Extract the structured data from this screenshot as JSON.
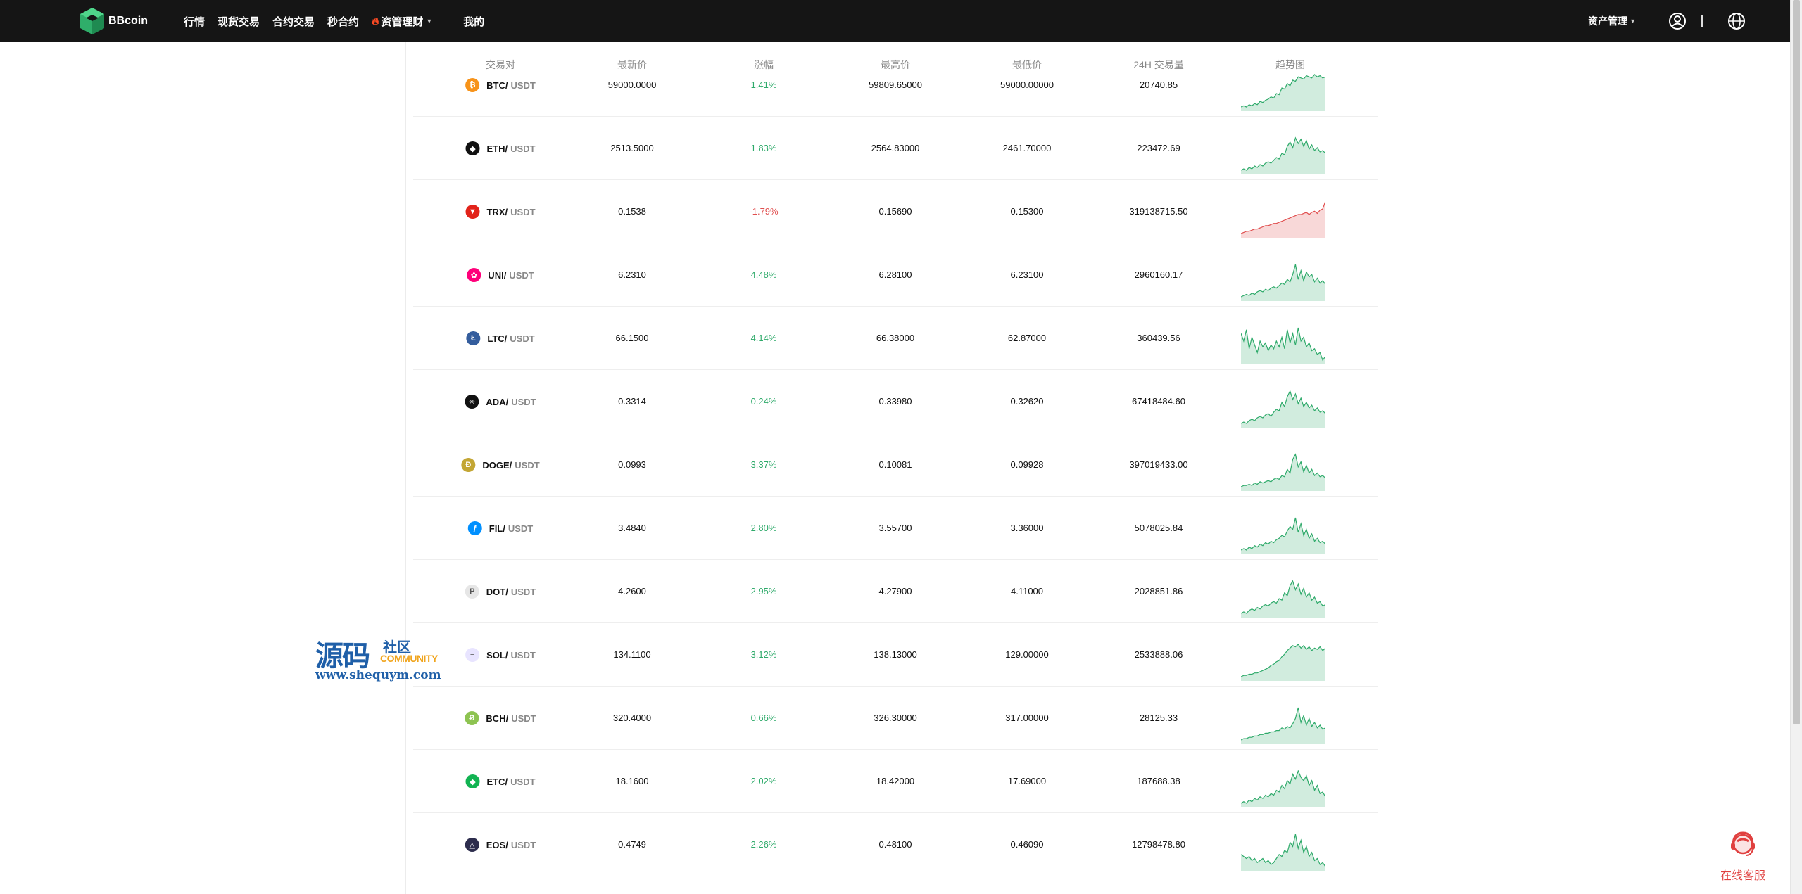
{
  "brand": {
    "name": "BBcoin"
  },
  "nav": {
    "items": [
      {
        "label": "行情"
      },
      {
        "label": "现货交易"
      },
      {
        "label": "合约交易"
      },
      {
        "label": "秒合约"
      },
      {
        "label": "资管理财",
        "hot": true,
        "dropdown": true
      },
      {
        "label": "我的"
      }
    ],
    "asset_management": "资产管理",
    "icons": {
      "user": "user-circle-icon",
      "language": "globe-icon"
    }
  },
  "table": {
    "headers": [
      "交易对",
      "最新价",
      "涨幅",
      "最高价",
      "最低价",
      "24H 交易量",
      "趋势图"
    ],
    "rows": [
      {
        "base": "BTC/",
        "quote": "USDT",
        "price": "59000.0000",
        "change": "1.41%",
        "high": "59809.65000",
        "low": "59000.00000",
        "volume": "20740.85",
        "direction": "up",
        "icon_color": "#f7931a",
        "icon_glyph": "₿",
        "spark": [
          3,
          4,
          3,
          5,
          4,
          6,
          5,
          8,
          7,
          9,
          10,
          12,
          11,
          15,
          14,
          20,
          19,
          24,
          22,
          27,
          26,
          30,
          29,
          28,
          31,
          30,
          29,
          32,
          30,
          31,
          29,
          30
        ]
      },
      {
        "base": "ETH/",
        "quote": "USDT",
        "price": "2513.5000",
        "change": "1.83%",
        "high": "2564.83000",
        "low": "2461.70000",
        "volume": "223472.69",
        "direction": "up",
        "icon_color": "#111111",
        "icon_glyph": "◆",
        "spark": [
          5,
          6,
          5,
          7,
          6,
          8,
          7,
          9,
          8,
          10,
          11,
          10,
          12,
          14,
          13,
          17,
          16,
          22,
          25,
          21,
          28,
          24,
          27,
          22,
          26,
          20,
          23,
          19,
          21,
          18,
          19,
          17
        ]
      },
      {
        "base": "TRX/",
        "quote": "USDT",
        "price": "0.1538",
        "change": "-1.79%",
        "high": "0.15690",
        "low": "0.15300",
        "volume": "319138715.50",
        "direction": "down",
        "icon_color": "#e2231a",
        "icon_glyph": "▼",
        "spark": [
          3,
          4,
          5,
          5,
          6,
          7,
          7,
          8,
          9,
          10,
          10,
          11,
          12,
          12,
          13,
          14,
          15,
          16,
          17,
          18,
          19,
          20,
          20,
          21,
          22,
          20,
          22,
          23,
          21,
          24,
          25,
          32
        ]
      },
      {
        "base": "UNI/",
        "quote": "USDT",
        "price": "6.2310",
        "change": "4.48%",
        "high": "6.28100",
        "low": "6.23100",
        "volume": "2960160.17",
        "direction": "up",
        "icon_color": "#ff007a",
        "icon_glyph": "✿",
        "spark": [
          4,
          5,
          6,
          5,
          7,
          6,
          8,
          9,
          8,
          10,
          9,
          11,
          12,
          11,
          13,
          15,
          14,
          18,
          16,
          22,
          30,
          18,
          25,
          17,
          24,
          20,
          22,
          16,
          19,
          15,
          17,
          14
        ]
      },
      {
        "base": "LTC/",
        "quote": "USDT",
        "price": "66.1500",
        "change": "4.14%",
        "high": "66.38000",
        "low": "62.87000",
        "volume": "360439.56",
        "direction": "up",
        "icon_color": "#345d9d",
        "icon_glyph": "Ł",
        "spark": [
          22,
          18,
          24,
          14,
          20,
          16,
          12,
          18,
          15,
          17,
          13,
          16,
          14,
          18,
          15,
          20,
          14,
          24,
          17,
          22,
          16,
          25,
          18,
          20,
          15,
          17,
          13,
          14,
          11,
          12,
          8,
          10
        ]
      },
      {
        "base": "ADA/",
        "quote": "USDT",
        "price": "0.3314",
        "change": "0.24%",
        "high": "0.33980",
        "low": "0.32620",
        "volume": "67418484.60",
        "direction": "up",
        "icon_color": "#111111",
        "icon_glyph": "✳",
        "spark": [
          5,
          6,
          5,
          7,
          8,
          7,
          9,
          10,
          9,
          11,
          12,
          10,
          13,
          15,
          14,
          20,
          17,
          24,
          28,
          22,
          26,
          19,
          23,
          17,
          20,
          16,
          18,
          14,
          16,
          13,
          14,
          12
        ]
      },
      {
        "base": "DOGE/",
        "quote": "USDT",
        "price": "0.0993",
        "change": "3.37%",
        "high": "0.10081",
        "low": "0.09928",
        "volume": "397019433.00",
        "direction": "up",
        "icon_color": "#c3a634",
        "icon_glyph": "Ð",
        "spark": [
          4,
          5,
          5,
          6,
          5,
          7,
          6,
          8,
          7,
          8,
          9,
          8,
          10,
          11,
          10,
          13,
          12,
          18,
          15,
          26,
          30,
          20,
          24,
          16,
          21,
          15,
          18,
          13,
          15,
          12,
          13,
          11
        ]
      },
      {
        "base": "FIL/",
        "quote": "USDT",
        "price": "3.4840",
        "change": "2.80%",
        "high": "3.55700",
        "low": "3.36000",
        "volume": "5078025.84",
        "direction": "up",
        "icon_color": "#0090ff",
        "icon_glyph": "ƒ",
        "spark": [
          6,
          7,
          6,
          8,
          7,
          9,
          8,
          10,
          9,
          11,
          10,
          12,
          11,
          13,
          14,
          16,
          15,
          19,
          22,
          20,
          28,
          18,
          24,
          16,
          20,
          14,
          17,
          12,
          14,
          11,
          12,
          10
        ]
      },
      {
        "base": "DOT/",
        "quote": "USDT",
        "price": "4.2600",
        "change": "2.95%",
        "high": "4.27900",
        "low": "4.11000",
        "volume": "2028851.86",
        "direction": "up",
        "icon_color": "#e6e6e6",
        "icon_glyph": "P",
        "spark": [
          6,
          7,
          6,
          8,
          9,
          8,
          10,
          9,
          11,
          12,
          11,
          13,
          14,
          13,
          16,
          15,
          20,
          18,
          25,
          28,
          22,
          26,
          19,
          23,
          17,
          20,
          15,
          17,
          13,
          14,
          11,
          12
        ]
      },
      {
        "base": "SOL/",
        "quote": "USDT",
        "price": "134.1100",
        "change": "3.12%",
        "high": "138.13000",
        "low": "129.00000",
        "volume": "2533888.06",
        "direction": "up",
        "icon_color": "#e8e4ff",
        "icon_glyph": "≡",
        "spark": [
          3,
          4,
          4,
          5,
          5,
          6,
          6,
          7,
          8,
          9,
          10,
          12,
          13,
          15,
          16,
          19,
          21,
          24,
          26,
          28,
          27,
          29,
          26,
          28,
          25,
          27,
          24,
          26,
          25,
          27,
          24,
          26
        ]
      },
      {
        "base": "BCH/",
        "quote": "USDT",
        "price": "320.4000",
        "change": "0.66%",
        "high": "326.30000",
        "low": "317.00000",
        "volume": "28125.33",
        "direction": "up",
        "icon_color": "#8dc351",
        "icon_glyph": "Ƀ",
        "spark": [
          6,
          7,
          7,
          8,
          8,
          9,
          9,
          10,
          10,
          11,
          11,
          12,
          12,
          13,
          13,
          15,
          14,
          16,
          15,
          18,
          22,
          30,
          19,
          24,
          17,
          22,
          16,
          19,
          15,
          17,
          14,
          15
        ]
      },
      {
        "base": "ETC/",
        "quote": "USDT",
        "price": "18.1600",
        "change": "2.02%",
        "high": "18.42000",
        "low": "17.69000",
        "volume": "187688.38",
        "direction": "up",
        "icon_color": "#12b352",
        "icon_glyph": "◆",
        "spark": [
          8,
          9,
          8,
          10,
          9,
          11,
          10,
          12,
          11,
          13,
          12,
          14,
          13,
          16,
          15,
          19,
          17,
          22,
          20,
          26,
          23,
          28,
          24,
          22,
          25,
          19,
          22,
          16,
          19,
          14,
          15,
          12
        ]
      },
      {
        "base": "EOS/",
        "quote": "USDT",
        "price": "0.4749",
        "change": "2.26%",
        "high": "0.48100",
        "low": "0.46090",
        "volume": "12798478.80",
        "direction": "up",
        "icon_color": "#2d2d4d",
        "icon_glyph": "△",
        "spark": [
          14,
          13,
          12,
          13,
          11,
          12,
          10,
          11,
          12,
          10,
          11,
          9,
          10,
          12,
          14,
          13,
          16,
          15,
          20,
          18,
          24,
          17,
          21,
          15,
          18,
          13,
          15,
          11,
          12,
          9,
          10,
          8
        ]
      }
    ]
  },
  "watermark": {
    "big": "源码",
    "small": "社区",
    "community": "COMMUNITY",
    "url": "www.shequym.com"
  },
  "support": {
    "label": "在线客服"
  },
  "colors": {
    "up": "#2eaa6a",
    "down": "#e04e4e",
    "topbar": "#151515"
  }
}
